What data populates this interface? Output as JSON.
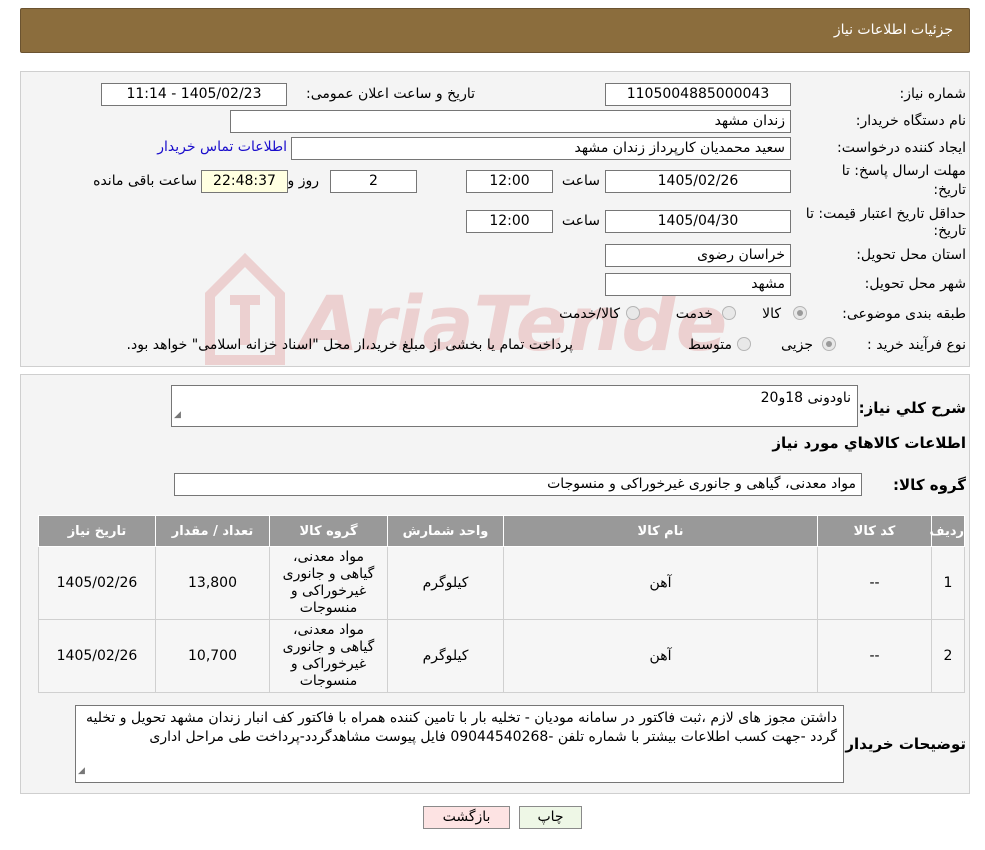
{
  "header": {
    "title": "جزئیات اطلاعات نیاز"
  },
  "watermark": {
    "text": "AriaTender.neT",
    "color": "#c62828"
  },
  "details": {
    "need_number_label": "شماره نیاز:",
    "need_number": "1105004885000043",
    "announce_label": "تاریخ و ساعت اعلان عمومی:",
    "announce_value": "1405/02/23 - 11:14",
    "buyer_org_label": "نام دستگاه خریدار:",
    "buyer_org": "زندان مشهد",
    "creator_label": "ایجاد کننده درخواست:",
    "creator": "سعید محمدیان کارپرداز زندان مشهد",
    "contact_link": "اطلاعات تماس خریدار",
    "reply_deadline_label_1": "مهلت ارسال پاسخ: تا",
    "reply_deadline_label_2": "تاریخ:",
    "reply_date": "1405/02/26",
    "time_label": "ساعت",
    "reply_time": "12:00",
    "days_value": "2",
    "days_label": "روز و",
    "remaining_time": "22:48:37",
    "remaining_label": "ساعت باقی مانده",
    "validity_label_1": "حداقل تاریخ اعتبار قیمت: تا",
    "validity_label_2": "تاریخ:",
    "validity_date": "1405/04/30",
    "validity_time": "12:00",
    "province_label": "استان محل تحویل:",
    "province": "خراسان رضوی",
    "city_label": "شهر محل تحویل:",
    "city": "مشهد",
    "category_label": "طبقه بندی موضوعی:",
    "category_options": [
      "کالا",
      "خدمت",
      "کالا/خدمت"
    ],
    "category_selected": "کالا",
    "process_label": "نوع فرآیند خرید :",
    "process_options": [
      "جزیی",
      "متوسط"
    ],
    "process_selected": "جزیی",
    "process_note": "پرداخت تمام یا بخشی از مبلغ خرید،از محل \"اسناد خزانه اسلامی\" خواهد بود."
  },
  "need": {
    "summary_label": "شرح کلي نياز:",
    "summary": "ناودونی 18و20",
    "goods_info_title": "اطلاعات کالاهاي مورد نياز",
    "goods_group_label": "گروه کالا:",
    "goods_group": "مواد معدنی، گیاهی و جانوری غیرخوراکی و منسوجات"
  },
  "table": {
    "headers": [
      "رديف",
      "کد کالا",
      "نام کالا",
      "واحد شمارش",
      "گروه کالا",
      "تعداد / مقدار",
      "تاریخ نیاز"
    ],
    "rows": [
      {
        "index": "1",
        "code": "--",
        "name": "آهن",
        "unit": "کیلوگرم",
        "group": "مواد معدنی، گیاهی و جانوری غیرخوراکی و منسوجات",
        "quantity": "13,800",
        "date": "1405/02/26"
      },
      {
        "index": "2",
        "code": "--",
        "name": "آهن",
        "unit": "کیلوگرم",
        "group": "مواد معدنی، گیاهی و جانوری غیرخوراکی و منسوجات",
        "quantity": "10,700",
        "date": "1405/02/26"
      }
    ]
  },
  "notes": {
    "label": "توضیحات خریدار:",
    "text": "داشتن مجوز های لازم ،ثبت فاکتور در سامانه مودیان - تخلیه بار با تامین کننده همراه با فاکتور  کف انبار زندان مشهد تحویل و تخلیه گردد -جهت کسب اطلاعات بیشتر با شماره تلفن -09044540268 فایل پیوست مشاهدگردد-پرداخت طی مراحل اداری"
  },
  "buttons": {
    "print": "چاپ",
    "back": "بازگشت"
  }
}
